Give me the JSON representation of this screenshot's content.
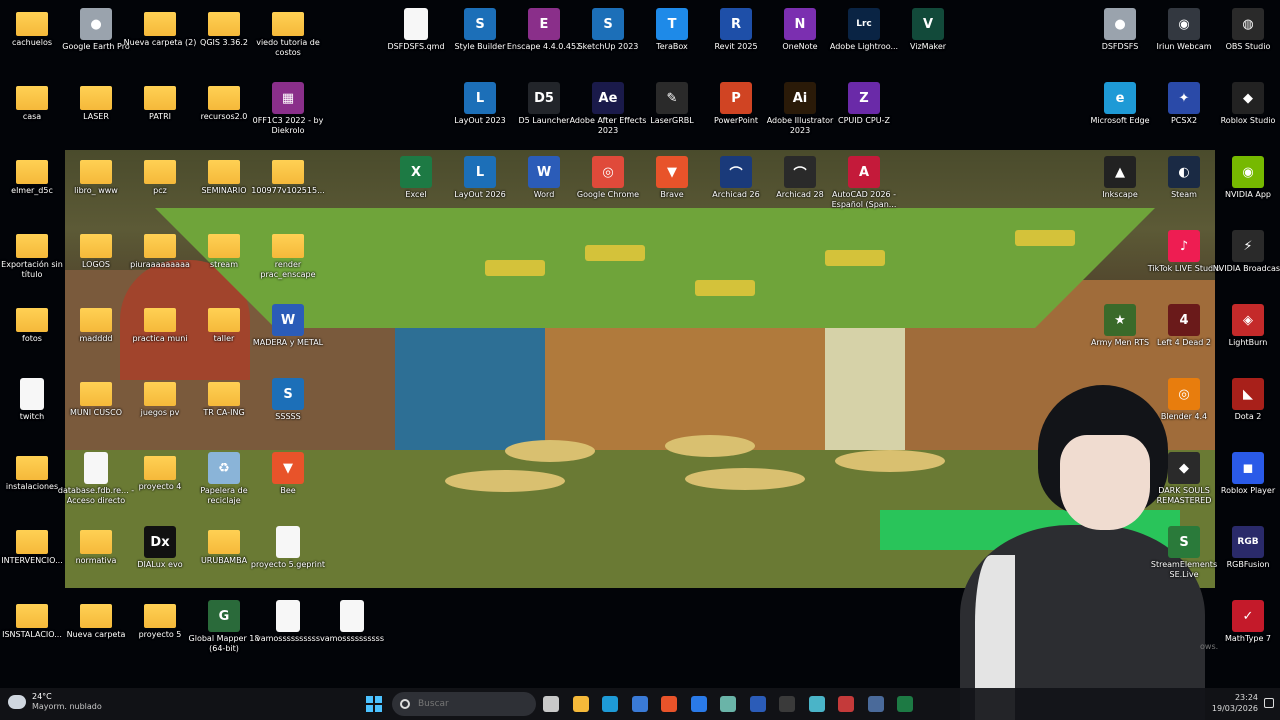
{
  "desktop": {
    "icons": [
      {
        "label": "cachuelos",
        "type": "folder-icon"
      },
      {
        "label": "Google Earth Pro",
        "type": "google-earth-icon",
        "color": "#9aa3ad",
        "glyph": "●"
      },
      {
        "label": "Nueva carpeta (2)",
        "type": "folder-icon"
      },
      {
        "label": "QGIS 3.36.2",
        "type": "folder-icon"
      },
      {
        "label": "viedo tutoria de costos",
        "type": "folder-icon"
      },
      {
        "label": "DSFDSFS.qmd",
        "type": "document-icon"
      },
      {
        "label": "Style Builder",
        "type": "sketchup-icon",
        "color": "#1c6fb8",
        "glyph": "S"
      },
      {
        "label": "Enscape 4.4.0.452",
        "type": "winrar-icon",
        "color": "#8a2f8a",
        "glyph": "E"
      },
      {
        "label": "SketchUp 2023",
        "type": "sketchup-icon",
        "color": "#1c6fb8",
        "glyph": "S"
      },
      {
        "label": "TeraBox",
        "type": "terabox-icon",
        "color": "#1e8ae8",
        "glyph": "T"
      },
      {
        "label": "Revit 2025",
        "type": "revit-icon",
        "color": "#1e4fa8",
        "glyph": "R"
      },
      {
        "label": "OneNote",
        "type": "onenote-icon",
        "color": "#7b2fb0",
        "glyph": "N"
      },
      {
        "label": "Adobe Lightroo...",
        "type": "lightroom-icon",
        "color": "#0a2444",
        "glyph": "Lrc"
      },
      {
        "label": "VizMaker",
        "type": "vizmaker-icon",
        "color": "#124a3a",
        "glyph": "V"
      },
      {
        "label": "DSFDSFS",
        "type": "google-earth-icon",
        "color": "#9aa3ad",
        "glyph": "●"
      },
      {
        "label": "Iriun Webcam",
        "type": "webcam-icon",
        "color": "#333840",
        "glyph": "◉"
      },
      {
        "label": "OBS Studio",
        "type": "obs-icon",
        "color": "#2a2a2a",
        "glyph": "◍"
      },
      {
        "label": "casa",
        "type": "folder-icon"
      },
      {
        "label": "LASER",
        "type": "folder-icon"
      },
      {
        "label": "PATRI",
        "type": "folder-icon"
      },
      {
        "label": "recursos2.0",
        "type": "folder-icon"
      },
      {
        "label": "0FF1C3 2022 - by Diekrolo",
        "type": "winrar-icon",
        "color": "#8a2f8a",
        "glyph": "▦"
      },
      {
        "label": "LayOut 2023",
        "type": "layout-icon",
        "color": "#1c6fb8",
        "glyph": "L"
      },
      {
        "label": "D5 Launcher",
        "type": "d5-icon",
        "color": "#22252a",
        "glyph": "D5"
      },
      {
        "label": "Adobe After Effects 2023",
        "type": "after-effects-icon",
        "color": "#1a1a4a",
        "glyph": "Ae"
      },
      {
        "label": "LaserGRBL",
        "type": "lasergrbl-icon",
        "color": "#2a2a2a",
        "glyph": "✎"
      },
      {
        "label": "PowerPoint",
        "type": "powerpoint-icon",
        "color": "#d04423",
        "glyph": "P"
      },
      {
        "label": "Adobe Illustrator 2023",
        "type": "illustrator-icon",
        "color": "#2a1a08",
        "glyph": "Ai"
      },
      {
        "label": "CPUID CPU-Z",
        "type": "cpuz-icon",
        "color": "#6a2aa8",
        "glyph": "Z"
      },
      {
        "label": "Microsoft Edge",
        "type": "edge-icon",
        "color": "#1e9ad6",
        "glyph": "e"
      },
      {
        "label": "PCSX2",
        "type": "pcsx2-icon",
        "color": "#2a4aa8",
        "glyph": "✦"
      },
      {
        "label": "Roblox Studio",
        "type": "roblox-studio-icon",
        "color": "#222",
        "glyph": "◆"
      },
      {
        "label": "elmer_d5c",
        "type": "folder-icon"
      },
      {
        "label": "libro_ www",
        "type": "folder-icon"
      },
      {
        "label": "pcz",
        "type": "folder-icon"
      },
      {
        "label": "SEMINARIO",
        "type": "folder-icon"
      },
      {
        "label": "100977v102515...",
        "type": "folder-icon"
      },
      {
        "label": "Excel",
        "type": "excel-icon",
        "color": "#1d7a44",
        "glyph": "X"
      },
      {
        "label": "LayOut 2026",
        "type": "layout-icon",
        "color": "#1c6fb8",
        "glyph": "L"
      },
      {
        "label": "Word",
        "type": "word-icon",
        "color": "#2b5cb8",
        "glyph": "W"
      },
      {
        "label": "Google Chrome",
        "type": "chrome-icon",
        "color": "#e04a3a",
        "glyph": "◎"
      },
      {
        "label": "Brave",
        "type": "brave-icon",
        "color": "#e8532a",
        "glyph": "▼"
      },
      {
        "label": "Archicad 26",
        "type": "archicad-icon",
        "color": "#1a3a7a",
        "glyph": "⌒"
      },
      {
        "label": "Archicad 28",
        "type": "archicad-icon",
        "color": "#2a2a2a",
        "glyph": "⌒"
      },
      {
        "label": "AutoCAD 2026 - Español (Span...",
        "type": "autocad-icon",
        "color": "#c41a3a",
        "glyph": "A"
      },
      {
        "label": "Inkscape",
        "type": "inkscape-icon",
        "color": "#222",
        "glyph": "▲"
      },
      {
        "label": "Steam",
        "type": "steam-icon",
        "color": "#1a2a44",
        "glyph": "◐"
      },
      {
        "label": "NVIDIA App",
        "type": "nvidia-icon",
        "color": "#76b900",
        "glyph": "◉"
      },
      {
        "label": "Exportación sin título",
        "type": "folder-icon"
      },
      {
        "label": "LOGOS",
        "type": "folder-icon"
      },
      {
        "label": "piuraaaaaaaaa",
        "type": "folder-icon"
      },
      {
        "label": "stream",
        "type": "folder-icon"
      },
      {
        "label": "render prac_enscape",
        "type": "folder-icon"
      },
      {
        "label": "TikTok LIVE Studio",
        "type": "tiktok-icon",
        "color": "#ee1d52",
        "glyph": "♪"
      },
      {
        "label": "NVIDIA Broadcast",
        "type": "nvidia-icon",
        "color": "#2a2a2a",
        "glyph": "⚡"
      },
      {
        "label": "fotos",
        "type": "folder-icon"
      },
      {
        "label": "madddd",
        "type": "folder-icon"
      },
      {
        "label": "practica muni",
        "type": "folder-icon"
      },
      {
        "label": "taller",
        "type": "folder-icon"
      },
      {
        "label": "MADERA y METAL",
        "type": "word-icon",
        "color": "#2b5cb8",
        "glyph": "W"
      },
      {
        "label": "Army Men RTS",
        "type": "game-icon",
        "color": "#3a6a2a",
        "glyph": "★"
      },
      {
        "label": "Left 4 Dead 2",
        "type": "game-icon",
        "color": "#6a1a1a",
        "glyph": "4"
      },
      {
        "label": "LightBurn",
        "type": "lightburn-icon",
        "color": "#c42a2a",
        "glyph": "◈"
      },
      {
        "label": "twitch",
        "type": "document-icon"
      },
      {
        "label": "MUNI CUSCO",
        "type": "folder-icon"
      },
      {
        "label": "juegos pv",
        "type": "folder-icon"
      },
      {
        "label": "TR CA-ING",
        "type": "folder-icon"
      },
      {
        "label": "SSSSS",
        "type": "sketchup-icon",
        "color": "#1c6fb8",
        "glyph": "S"
      },
      {
        "label": "Blender 4.4",
        "type": "blender-icon",
        "color": "#e87d0d",
        "glyph": "◎"
      },
      {
        "label": "Dota 2",
        "type": "dota-icon",
        "color": "#a8201a",
        "glyph": "◣"
      },
      {
        "label": "instalaciones",
        "type": "folder-icon"
      },
      {
        "label": "database.fdb.re... - Acceso directo",
        "type": "document-icon"
      },
      {
        "label": "proyecto 4",
        "type": "folder-icon"
      },
      {
        "label": "Papelera de reciclaje",
        "type": "recycle-bin-icon",
        "color": "#8ab4d8",
        "glyph": "♻"
      },
      {
        "label": "Bee",
        "type": "brave-icon",
        "color": "#e8532a",
        "glyph": "▼"
      },
      {
        "label": "DARK SOULS REMASTERED",
        "type": "game-icon",
        "color": "#2a2a2a",
        "glyph": "◆"
      },
      {
        "label": "Roblox Player",
        "type": "roblox-icon",
        "color": "#2a5ae8",
        "glyph": "◼"
      },
      {
        "label": "INTERVENCIO...",
        "type": "folder-icon"
      },
      {
        "label": "normativa",
        "type": "folder-icon"
      },
      {
        "label": "DIALux evo",
        "type": "dialux-icon",
        "color": "#111",
        "glyph": "Dx"
      },
      {
        "label": "URUBAMBA",
        "type": "folder-icon"
      },
      {
        "label": "proyecto 5.geprint",
        "type": "document-icon"
      },
      {
        "label": "StreamElements SE.Live",
        "type": "streamelements-icon",
        "color": "#2a7a3a",
        "glyph": "S"
      },
      {
        "label": "RGBFusion",
        "type": "rgb-icon",
        "color": "#2a2a6a",
        "glyph": "RGB"
      },
      {
        "label": "ISNSTALACIO...",
        "type": "folder-icon"
      },
      {
        "label": "Nueva carpeta",
        "type": "folder-icon"
      },
      {
        "label": "proyecto 5",
        "type": "folder-icon"
      },
      {
        "label": "Global Mapper 18 (64-bit)",
        "type": "global-mapper-icon",
        "color": "#2a6a3a",
        "glyph": "G"
      },
      {
        "label": "vamossssssssss",
        "type": "document-icon"
      },
      {
        "label": "vamossssssssss",
        "type": "document-icon"
      },
      {
        "label": "MathType 7",
        "type": "mathtype-icon",
        "color": "#c41a2a",
        "glyph": "✓"
      }
    ]
  },
  "overlay": {
    "ghost_text": "ows."
  },
  "taskbar": {
    "weather": {
      "temp": "24°C",
      "desc": "Mayorm. nublado",
      "icon": "cloud-icon"
    },
    "search_placeholder": "Buscar",
    "apps": [
      {
        "name": "task-view-icon",
        "color": "#c8c8c8"
      },
      {
        "name": "file-explorer-icon",
        "color": "#f5b93a"
      },
      {
        "name": "edge-icon",
        "color": "#1e9ad6"
      },
      {
        "name": "store-icon",
        "color": "#3a7ad6"
      },
      {
        "name": "brave-icon",
        "color": "#e8532a"
      },
      {
        "name": "vscode-icon",
        "color": "#2a7ae8"
      },
      {
        "name": "notepad-icon",
        "color": "#6ab4a8"
      },
      {
        "name": "word-icon",
        "color": "#2b5cb8"
      },
      {
        "name": "obs-icon",
        "color": "#3a3a3a"
      },
      {
        "name": "vizmaker-icon",
        "color": "#4ab4c8"
      },
      {
        "name": "sketchup-icon",
        "color": "#c43a3a"
      },
      {
        "name": "steam-icon",
        "color": "#4a6a9a"
      },
      {
        "name": "excel-icon",
        "color": "#1d7a44"
      }
    ],
    "clock": {
      "time": "23:24",
      "date": "19/03/2026"
    }
  }
}
